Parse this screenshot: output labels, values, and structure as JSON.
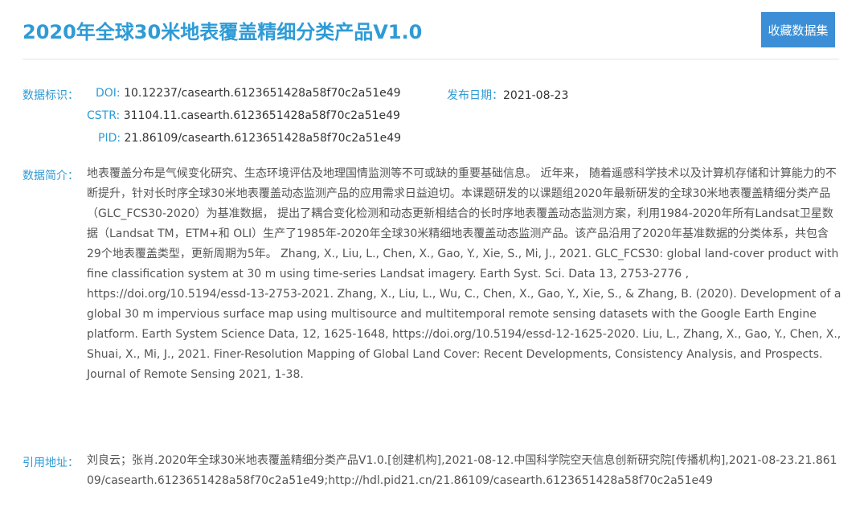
{
  "header": {
    "title": "2020年全球30米地表覆盖精细分类产品V1.0",
    "favorite_button": "收藏数据集"
  },
  "identifiers": {
    "label": "数据标识：",
    "doi_key": "DOI:",
    "doi_value": "10.12237/casearth.6123651428a58f70c2a51e49",
    "cstr_key": "CSTR:",
    "cstr_value": "31104.11.casearth.6123651428a58f70c2a51e49",
    "pid_key": "PID:",
    "pid_value": "21.86109/casearth.6123651428a58f70c2a51e49",
    "publish_date_key": "发布日期：",
    "publish_date_value": "2021-08-23"
  },
  "abstract": {
    "label": "数据简介：",
    "text": "地表覆盖分布是气候变化研究、生态环境评估及地理国情监测等不可或缺的重要基础信息。 近年来， 随着遥感科学技术以及计算机存储和计算能力的不断提升，针对长时序全球30米地表覆盖动态监测产品的应用需求日益迫切。本课题研发的以课题组2020年最新研发的全球30米地表覆盖精细分类产品（GLC_FCS30-2020）为基准数据， 提出了耦合变化检测和动态更新相结合的长时序地表覆盖动态监测方案，利用1984-2020年所有Landsat卫星数据（Landsat TM，ETM+和 OLI）生产了1985年-2020年全球30米精细地表覆盖动态监测产品。该产品沿用了2020年基准数据的分类体系，共包含29个地表覆盖类型，更新周期为5年。 Zhang, X., Liu, L., Chen, X., Gao, Y., Xie, S., Mi, J., 2021. GLC_FCS30: global land-cover product with fine classification system at 30 m using time-series Landsat imagery. Earth Syst. Sci. Data 13, 2753-2776 , https://doi.org/10.5194/essd-13-2753-2021. Zhang, X., Liu, L., Wu, C., Chen, X., Gao, Y., Xie, S., & Zhang, B. (2020). Development of a global 30 m impervious surface map using multisource and multitemporal remote sensing datasets with the Google Earth Engine platform. Earth System Science Data, 12, 1625-1648, https://doi.org/10.5194/essd-12-1625-2020. Liu, L., Zhang, X., Gao, Y., Chen, X., Shuai, X., Mi, J., 2021. Finer-Resolution Mapping of Global Land Cover: Recent Developments, Consistency Analysis, and Prospects. Journal of Remote Sensing 2021, 1-38."
  },
  "citation": {
    "label": "引用地址：",
    "text": "刘良云；张肖.2020年全球30米地表覆盖精细分类产品V1.0.[创建机构],2021-08-12.中国科学院空天信息创新研究院[传播机构],2021-08-23.21.86109/casearth.6123651428a58f70c2a51e49;http://hdl.pid21.cn/21.86109/casearth.6123651428a58f70c2a51e49"
  },
  "colors": {
    "accent": "#2e9bd6",
    "button": "#3c8fd6",
    "text": "#333333"
  }
}
